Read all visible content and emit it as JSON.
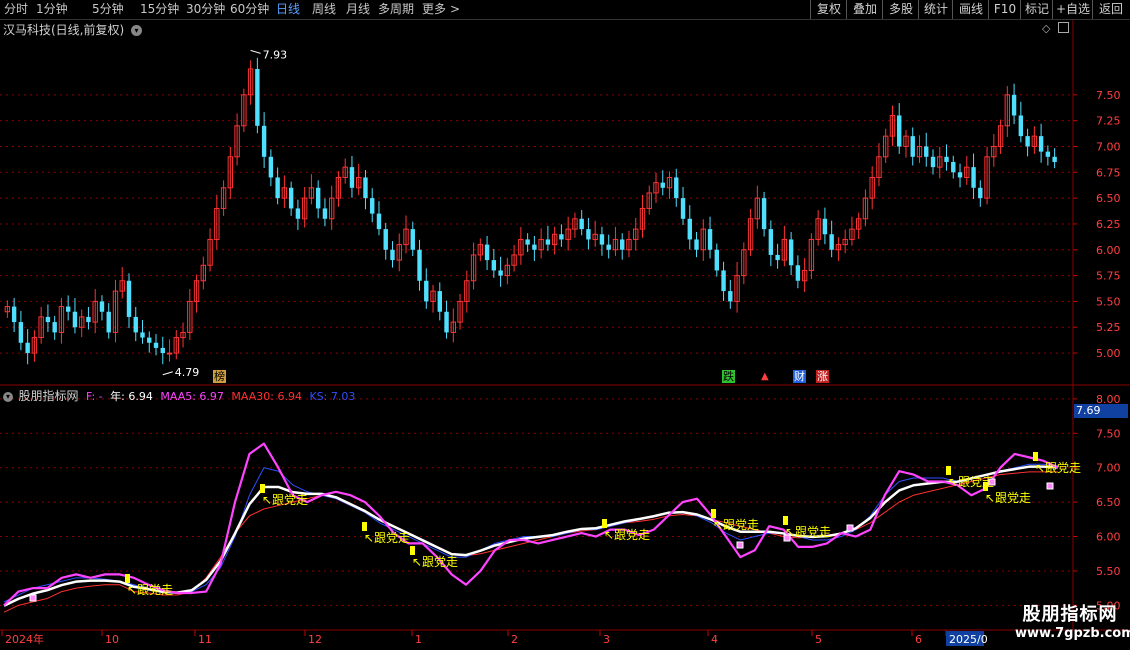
{
  "toolbar": {
    "periods": [
      "分时",
      "1分钟",
      "5分钟",
      "15分钟",
      "30分钟",
      "60分钟",
      "日线",
      "周线",
      "月线",
      "多周期",
      "更多"
    ],
    "active_period": "日线",
    "more_arrow": ">",
    "right_buttons": [
      "复权",
      "叠加",
      "多股",
      "统计",
      "画线",
      "F10",
      "标记",
      "+自选",
      "返回"
    ]
  },
  "panel": {
    "title": "汉马科技(日线,前复权)",
    "dropdown_icon": "chevron-down-icon",
    "diamond_icon": "diamond-icon",
    "square_icon": "square-icon"
  },
  "indicator": {
    "name": "股朋指标网",
    "f_label": "F: -",
    "year_label": "年: 6.94",
    "maa5_label": "MAA5: 6.97",
    "maa30_label": "MAA30: 6.94",
    "ks_label": "KS: 7.03",
    "current_value": "7.69",
    "signal_text": "跟党走",
    "colors": {
      "maa5": "#ff44ff",
      "maa30": "#ff3030",
      "ks": "#3050ff",
      "line_white": "#ffffff",
      "signal": "#ffff00"
    }
  },
  "markers": {
    "bang": "榜",
    "die": "跌",
    "cai": "财",
    "zhang": "涨"
  },
  "watermark": {
    "line1": "股朋指标网",
    "line2": "www.7gpzb.com"
  },
  "colors": {
    "up": "#ff3333",
    "down": "#50e0ff",
    "grid": "#8b0000",
    "axis_text": "#c0c0c0"
  },
  "chart_data": [
    {
      "type": "candlestick",
      "title": "汉马科技(日线,前复权)",
      "y_ticks": [
        "7.50",
        "7.25",
        "7.00",
        "6.75",
        "6.50",
        "6.25",
        "6.00",
        "5.75",
        "5.50",
        "5.25",
        "5.00"
      ],
      "ylim": [
        4.72,
        8.05
      ],
      "annotations": {
        "high": "7.93",
        "low": "4.79"
      },
      "x_labels": [
        "2024年",
        "10",
        "11",
        "12",
        "1",
        "2",
        "3",
        "4",
        "5",
        "6",
        "2025/0"
      ],
      "close": [
        5.45,
        5.3,
        5.1,
        5.0,
        5.15,
        5.35,
        5.3,
        5.2,
        5.45,
        5.4,
        5.25,
        5.35,
        5.3,
        5.5,
        5.4,
        5.2,
        5.6,
        5.7,
        5.35,
        5.2,
        5.15,
        5.1,
        5.05,
        5.0,
        5.0,
        5.15,
        5.2,
        5.5,
        5.7,
        5.85,
        6.1,
        6.4,
        6.6,
        6.9,
        7.2,
        7.5,
        7.75,
        7.2,
        6.9,
        6.7,
        6.5,
        6.6,
        6.4,
        6.3,
        6.5,
        6.6,
        6.4,
        6.3,
        6.5,
        6.7,
        6.8,
        6.6,
        6.7,
        6.5,
        6.35,
        6.2,
        6.0,
        5.9,
        6.05,
        6.2,
        6.0,
        5.7,
        5.5,
        5.6,
        5.4,
        5.2,
        5.3,
        5.5,
        5.7,
        5.95,
        6.05,
        5.9,
        5.8,
        5.75,
        5.85,
        5.95,
        6.1,
        6.05,
        6.0,
        6.1,
        6.05,
        6.15,
        6.1,
        6.2,
        6.3,
        6.2,
        6.1,
        6.15,
        6.05,
        6.0,
        6.1,
        6.0,
        6.1,
        6.2,
        6.4,
        6.55,
        6.65,
        6.6,
        6.7,
        6.5,
        6.3,
        6.1,
        6.0,
        6.2,
        6.0,
        5.8,
        5.6,
        5.5,
        5.75,
        6.0,
        6.3,
        6.5,
        6.2,
        5.95,
        5.9,
        6.1,
        5.85,
        5.7,
        5.8,
        6.1,
        6.3,
        6.15,
        6.0,
        6.05,
        6.1,
        6.2,
        6.3,
        6.5,
        6.7,
        6.9,
        7.1,
        7.3,
        7.0,
        7.1,
        6.9,
        7.0,
        6.9,
        6.8,
        6.9,
        6.85,
        6.75,
        6.7,
        6.8,
        6.6,
        6.5,
        6.9,
        7.0,
        7.2,
        7.5,
        7.3,
        7.1,
        7.0,
        7.1,
        6.95,
        6.9,
        6.85
      ]
    },
    {
      "type": "line",
      "title": "股朋指标网",
      "y_ticks": [
        "8.00",
        "7.50",
        "7.00",
        "6.50",
        "6.00",
        "5.50",
        "5.00"
      ],
      "ylim": [
        4.7,
        8.1
      ],
      "series": [
        {
          "name": "MAA5",
          "values": [
            5.0,
            5.2,
            5.25,
            5.25,
            5.4,
            5.45,
            5.4,
            5.45,
            5.45,
            5.4,
            5.3,
            5.22,
            5.18,
            5.18,
            5.2,
            5.6,
            6.5,
            7.2,
            7.35,
            7.0,
            6.6,
            6.5,
            6.6,
            6.65,
            6.6,
            6.5,
            6.3,
            6.05,
            5.9,
            5.9,
            5.7,
            5.45,
            5.3,
            5.5,
            5.8,
            5.95,
            5.95,
            5.9,
            5.95,
            6.0,
            6.05,
            6.0,
            6.1,
            6.1,
            6.02,
            6.1,
            6.3,
            6.5,
            6.55,
            6.3,
            6.0,
            5.7,
            5.8,
            6.15,
            6.1,
            5.85,
            5.85,
            5.9,
            6.05,
            6.0,
            6.1,
            6.6,
            6.95,
            6.9,
            6.8,
            6.8,
            6.75,
            6.6,
            6.7,
            7.0,
            7.2,
            7.15,
            7.1,
            7.0
          ]
        },
        {
          "name": "MAA30",
          "values": [
            4.9,
            5.0,
            5.05,
            5.1,
            5.2,
            5.25,
            5.28,
            5.3,
            5.3,
            5.2,
            5.18,
            5.15,
            5.15,
            5.2,
            5.4,
            5.7,
            6.05,
            6.3,
            6.4,
            6.45,
            6.5,
            6.55,
            6.6,
            6.55,
            6.45,
            6.35,
            6.25,
            6.15,
            6.05,
            5.95,
            5.85,
            5.75,
            5.72,
            5.75,
            5.8,
            5.85,
            5.9,
            5.95,
            6.0,
            6.05,
            6.08,
            6.1,
            6.15,
            6.2,
            6.22,
            6.25,
            6.3,
            6.32,
            6.3,
            6.25,
            6.2,
            6.15,
            6.1,
            6.05,
            6.0,
            5.98,
            6.0,
            6.02,
            6.05,
            6.1,
            6.2,
            6.35,
            6.5,
            6.6,
            6.65,
            6.7,
            6.75,
            6.8,
            6.85,
            6.9,
            6.92,
            6.94,
            6.94,
            6.94
          ]
        },
        {
          "name": "KS",
          "values": [
            5.05,
            5.15,
            5.25,
            5.3,
            5.35,
            5.4,
            5.4,
            5.38,
            5.35,
            5.3,
            5.25,
            5.2,
            5.18,
            5.2,
            5.3,
            5.55,
            6.0,
            6.6,
            7.0,
            6.95,
            6.75,
            6.65,
            6.6,
            6.55,
            6.45,
            6.35,
            6.2,
            6.1,
            6.0,
            5.9,
            5.8,
            5.7,
            5.7,
            5.8,
            5.9,
            5.95,
            6.0,
            6.0,
            6.0,
            6.05,
            6.1,
            6.1,
            6.15,
            6.2,
            6.25,
            6.3,
            6.35,
            6.35,
            6.3,
            6.2,
            6.05,
            5.95,
            6.0,
            6.05,
            6.05,
            6.0,
            5.95,
            5.95,
            6.0,
            6.1,
            6.3,
            6.6,
            6.8,
            6.85,
            6.85,
            6.85,
            6.8,
            6.85,
            6.9,
            6.95,
            7.0,
            7.05,
            7.05,
            7.03
          ]
        }
      ]
    }
  ]
}
